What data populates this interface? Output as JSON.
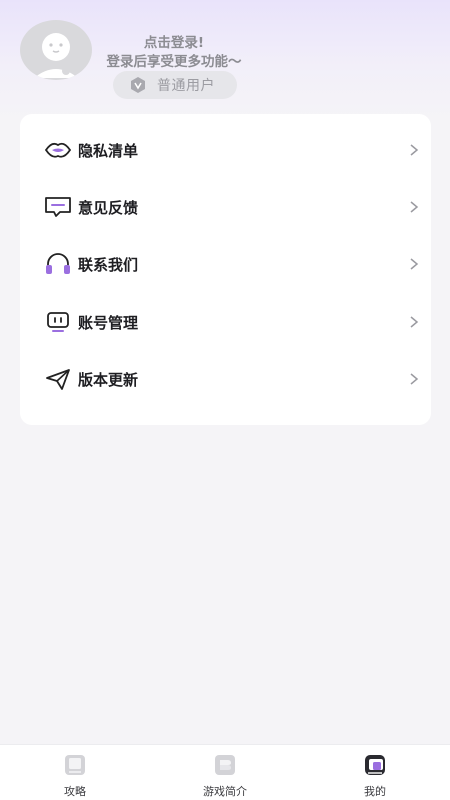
{
  "header": {
    "login_line1": "点击登录!",
    "login_line2": "登录后享受更多功能～",
    "badge_label": "普通用户",
    "badge_icon": "v-shield-icon"
  },
  "menu": {
    "items": [
      {
        "label": "隐私清单",
        "icon": "lips-icon"
      },
      {
        "label": "意见反馈",
        "icon": "message-icon"
      },
      {
        "label": "联系我们",
        "icon": "headset-icon"
      },
      {
        "label": "账号管理",
        "icon": "monitor-icon"
      },
      {
        "label": "版本更新",
        "icon": "send-icon"
      }
    ]
  },
  "tabbar": {
    "tabs": [
      {
        "label": "攻略",
        "icon": "book-icon",
        "active": false
      },
      {
        "label": "游戏简介",
        "icon": "document-icon",
        "active": false
      },
      {
        "label": "我的",
        "icon": "profile-icon",
        "active": true
      }
    ]
  },
  "colors": {
    "accent": "#9b6fe0",
    "text_dark": "#1e1e22",
    "text_gray": "#8c8c92"
  }
}
